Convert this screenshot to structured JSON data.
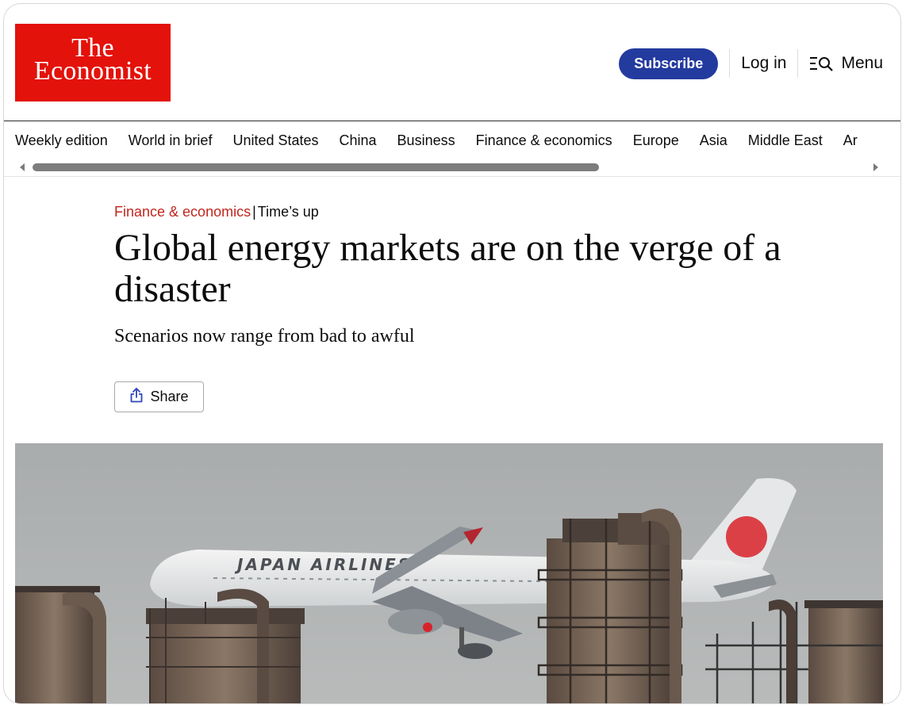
{
  "header": {
    "logo_line1": "The",
    "logo_line2": "Economist",
    "subscribe_label": "Subscribe",
    "login_label": "Log in",
    "menu_label": "Menu"
  },
  "nav": {
    "items": [
      "Weekly edition",
      "World in brief",
      "United States",
      "China",
      "Business",
      "Finance & economics",
      "Europe",
      "Asia",
      "Middle East",
      "Ar"
    ]
  },
  "article": {
    "section": "Finance & economics",
    "separator": "|",
    "flytitle": "Time’s up",
    "headline": "Global energy markets are on the verge of a disaster",
    "subheadline": "Scenarios now range from bad to awful",
    "share_label": "Share",
    "hero_plane_text": "JAPAN AIRLINES"
  },
  "colors": {
    "brand_red": "#e3120b",
    "subscribe_blue": "#233a9f",
    "section_red": "#c0261e"
  }
}
